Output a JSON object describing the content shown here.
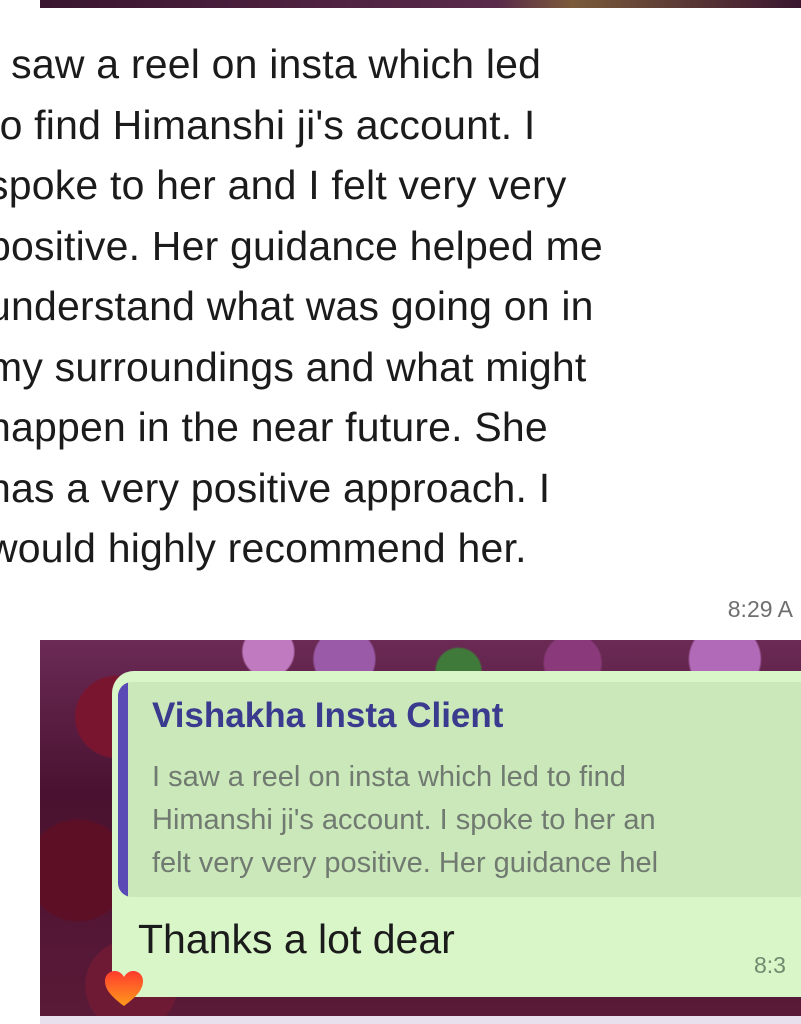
{
  "incoming_message": {
    "lines": [
      "I saw a reel on insta which led",
      "to find Himanshi ji's account. I",
      "spoke to her and I felt very very",
      "positive. Her guidance helped me",
      "understand what was going on in",
      "my surroundings and what might",
      "happen in the near future. She",
      "has a very positive approach. I",
      "would highly recommend her."
    ],
    "time": "8:29 A"
  },
  "reply_message": {
    "quoted_sender": "Vishakha Insta Client",
    "quoted_lines": [
      "I saw a reel on insta which led to find",
      "Himanshi ji's account. I spoke to her an",
      "felt very very positive. Her guidance hel"
    ],
    "text": "Thanks a lot dear",
    "time": "8:3",
    "reaction_icon": "heart-icon",
    "colors": {
      "bubble": "#d9f6c8",
      "quote_bar": "#5a4ab5",
      "sender": "#3a3a8e"
    }
  }
}
